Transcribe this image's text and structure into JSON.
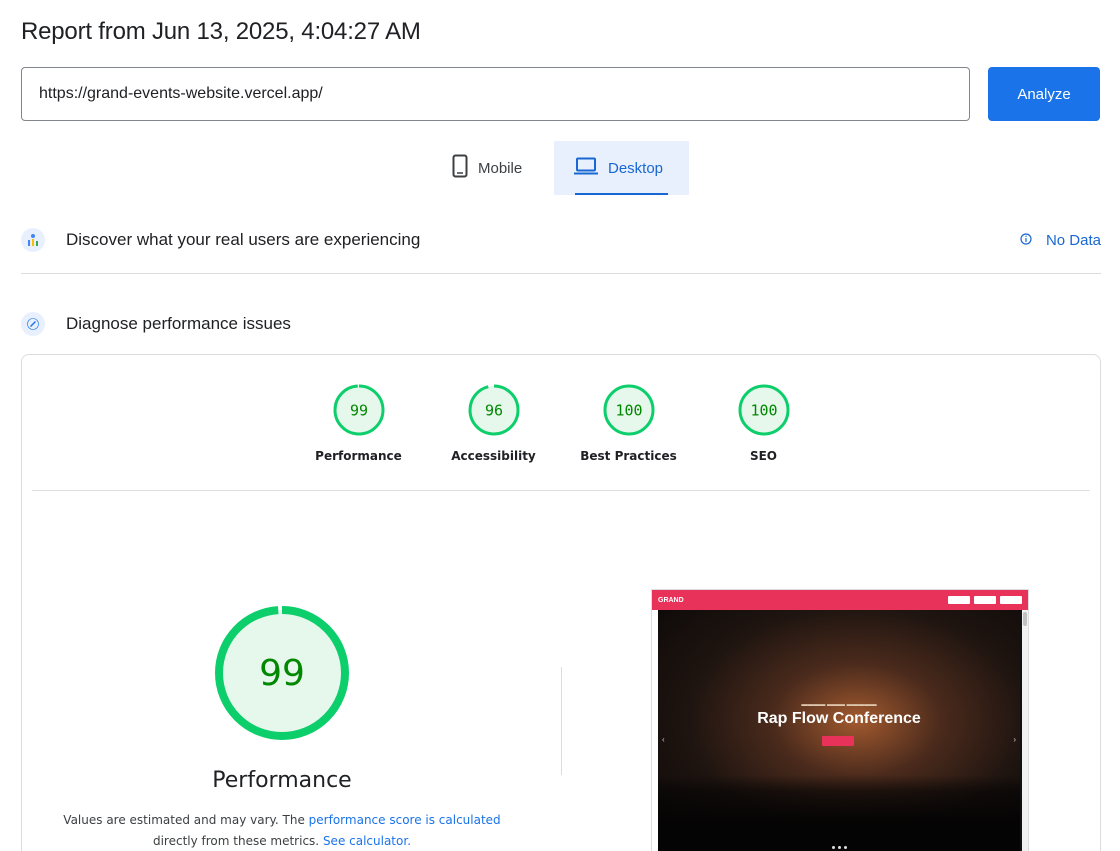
{
  "header": {
    "title": "Report from Jun 13, 2025, 4:04:27 AM"
  },
  "search": {
    "url_value": "https://grand-events-website.vercel.app/",
    "analyze_label": "Analyze"
  },
  "device_tabs": {
    "mobile_label": "Mobile",
    "desktop_label": "Desktop",
    "selected": "Desktop"
  },
  "real_users": {
    "title": "Discover what your real users are experiencing",
    "no_data_label": "No Data"
  },
  "diagnose": {
    "title": "Diagnose performance issues"
  },
  "scores": [
    {
      "label": "Performance",
      "score": "99",
      "fraction": 0.99
    },
    {
      "label": "Accessibility",
      "score": "96",
      "fraction": 0.96
    },
    {
      "label": "Best Practices",
      "score": "100",
      "fraction": 1.0
    },
    {
      "label": "SEO",
      "score": "100",
      "fraction": 1.0
    }
  ],
  "performance_detail": {
    "score": "99",
    "fraction": 0.99,
    "title": "Performance",
    "desc_before": "Values are estimated and may vary. The ",
    "desc_link1": "performance score is calculated",
    "desc_middle": " directly from these metrics. ",
    "desc_link2": "See calculator."
  },
  "screenshot": {
    "logo_text": "GRAND",
    "headline": "Rap Flow Conference"
  },
  "colors": {
    "accent": "#1a73e8",
    "good": "#0cce6b",
    "good_text": "#008800",
    "good_fill": "#e6f7ec",
    "tab_bg": "#e8f0fe"
  }
}
